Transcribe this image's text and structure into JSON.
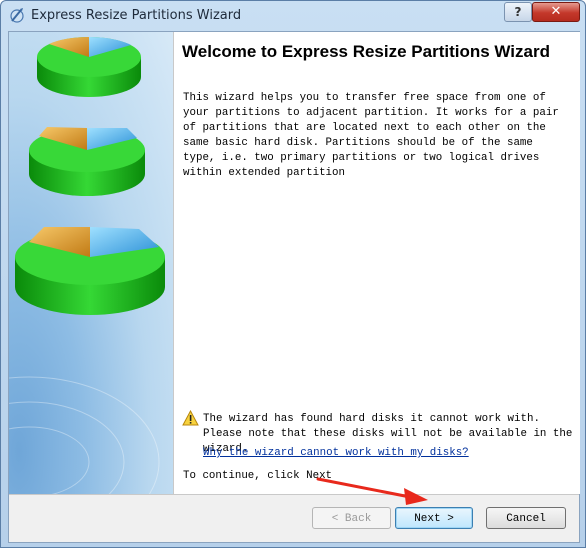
{
  "window": {
    "title": "Express Resize Partitions Wizard"
  },
  "titlebar_buttons": {
    "help": "?",
    "close": "✕"
  },
  "content": {
    "heading": "Welcome to Express Resize Partitions Wizard",
    "description": "This wizard helps you to transfer free space from one of your partitions to adjacent partition. It works for a pair of partitions that are located next to each other on the same basic hard disk. Partitions should be of the same type, i.e. two primary partitions or two logical drives within extended partition",
    "warning": "The wizard has found hard disks it cannot work with. Please note that these disks will not be available in the wizard.",
    "link": "Why the wizard cannot work with my disks?",
    "continue_text": "To continue, click Next"
  },
  "buttons": {
    "back": "< Back",
    "next": "Next >",
    "cancel": "Cancel"
  },
  "icons": {
    "app": "wizard-app-icon",
    "warning": "warning-icon",
    "side_art": "partition-disks-illustration",
    "annotation": "red-arrow-annotation"
  },
  "colors": {
    "link": "#00309c",
    "arrow": "#e8291c",
    "close": "#c4382b",
    "disk_green": "#1eb81e"
  }
}
